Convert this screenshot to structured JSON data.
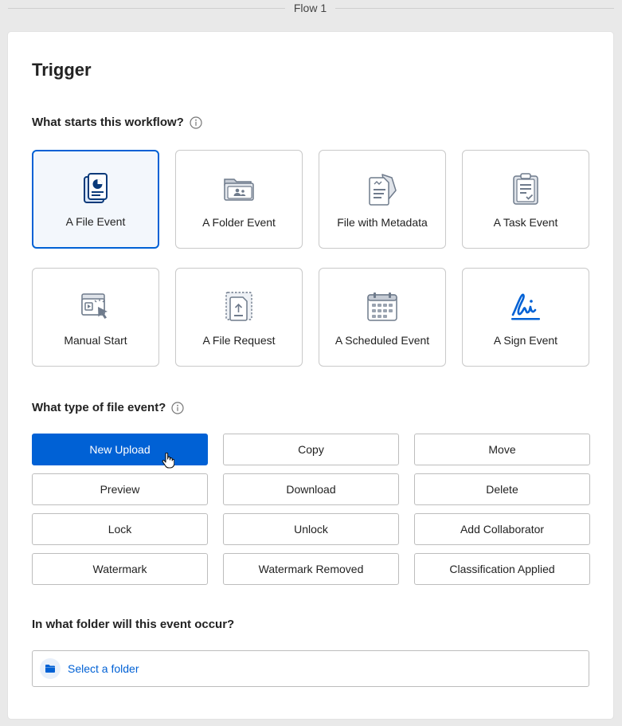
{
  "flow": {
    "title": "Flow 1"
  },
  "trigger": {
    "heading": "Trigger",
    "start_question": "What starts this workflow?",
    "tiles": [
      {
        "label": "A File Event",
        "icon": "file-event-icon",
        "selected": true
      },
      {
        "label": "A Folder Event",
        "icon": "folder-event-icon",
        "selected": false
      },
      {
        "label": "File with Metadata",
        "icon": "metadata-icon",
        "selected": false
      },
      {
        "label": "A Task Event",
        "icon": "task-icon",
        "selected": false
      },
      {
        "label": "Manual Start",
        "icon": "manual-start-icon",
        "selected": false
      },
      {
        "label": "A File Request",
        "icon": "file-request-icon",
        "selected": false
      },
      {
        "label": "A Scheduled Event",
        "icon": "calendar-icon",
        "selected": false
      },
      {
        "label": "A Sign Event",
        "icon": "sign-icon",
        "selected": false
      }
    ],
    "file_event_question": "What type of file event?",
    "file_events": [
      {
        "label": "New Upload",
        "active": true
      },
      {
        "label": "Copy",
        "active": false
      },
      {
        "label": "Move",
        "active": false
      },
      {
        "label": "Preview",
        "active": false
      },
      {
        "label": "Download",
        "active": false
      },
      {
        "label": "Delete",
        "active": false
      },
      {
        "label": "Lock",
        "active": false
      },
      {
        "label": "Unlock",
        "active": false
      },
      {
        "label": "Add Collaborator",
        "active": false
      },
      {
        "label": "Watermark",
        "active": false
      },
      {
        "label": "Watermark Removed",
        "active": false
      },
      {
        "label": "Classification Applied",
        "active": false
      }
    ],
    "folder_question": "In what folder will this event occur?",
    "folder_picker_label": "Select a folder"
  },
  "colors": {
    "accent": "#0061d5",
    "selected_tile_bg": "#f3f7fc",
    "icon_gray": "#6f7b8c"
  }
}
